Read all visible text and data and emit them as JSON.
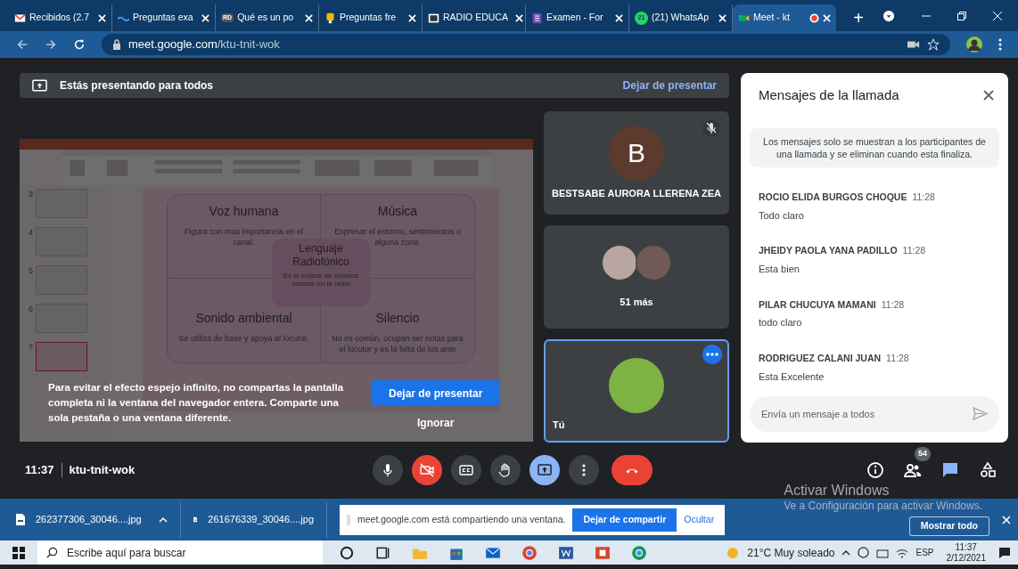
{
  "browser": {
    "tabs": [
      {
        "title": "Recibidos (2.7",
        "selected": false,
        "recording": false
      },
      {
        "title": "Preguntas exa",
        "selected": false,
        "recording": false
      },
      {
        "title": "Qué es un po",
        "badge": "RD",
        "selected": false,
        "recording": false
      },
      {
        "title": "Preguntas fre",
        "selected": false,
        "recording": false
      },
      {
        "title": "RADIO EDUCA",
        "selected": false,
        "recording": false
      },
      {
        "title": "Examen - For",
        "selected": false,
        "recording": false
      },
      {
        "title": "(21) WhatsAp",
        "badge": "21",
        "selected": false,
        "recording": false
      },
      {
        "title": "Meet - kt",
        "selected": true,
        "recording": true
      }
    ],
    "new_tab": "+",
    "host": "meet.google.com",
    "path": "/ktu-tnit-wok"
  },
  "presenting_banner": {
    "text": "Estás presentando para todos",
    "action": "Dejar de presentar"
  },
  "presentation": {
    "thumbnails": [
      "3",
      "4",
      "5",
      "6",
      "7"
    ],
    "cells": [
      {
        "title": "Voz humana",
        "body": "Figura con mas importancia en el canal."
      },
      {
        "title": "Música",
        "body": "Expresar el entorno, sentimientos o alguna zona."
      },
      {
        "title": "Sonido ambiental",
        "body": "Se utiliza de base y apoya al locutor."
      },
      {
        "title": "Silencio",
        "body": "No es común, ocupan ser notas para el locutor y es la falta de los ante"
      }
    ],
    "center": {
      "title": "Lenguaje Radiofónico",
      "body": "Es el enlace de sonidos usados en la radio"
    },
    "warning": {
      "text": "Para evitar el efecto espejo infinito, no compartas la pantalla completa ni la ventana del navegador entera. Comparte una sola pestaña o una ventana diferente.",
      "primary": "Dejar de presentar",
      "secondary": "Ignorar"
    }
  },
  "tiles": [
    {
      "kind": "initial",
      "initial": "B",
      "name": "BESTSABE AURORA LLERENA ZEA",
      "muted": true,
      "selected": false
    },
    {
      "kind": "group",
      "name": "51 más",
      "muted": false,
      "selected": false
    },
    {
      "kind": "self",
      "name": "Tú",
      "muted": false,
      "selected": true
    }
  ],
  "chat": {
    "title": "Mensajes de la llamada",
    "notice": "Los mensajes solo se muestran a los participantes de una llamada y se eliminan cuando esta finaliza.",
    "messages": [
      {
        "sender": "ROCIO ELIDA BURGOS CHOQUE",
        "time": "11:28",
        "text": "Todo claro"
      },
      {
        "sender": "JHEIDY PAOLA YANA PADILLO",
        "time": "11:28",
        "text": "Esta bien"
      },
      {
        "sender": "PILAR CHUCUYA MAMANI",
        "time": "11:28",
        "text": "todo claro"
      },
      {
        "sender": "RODRIGUEZ CALANI JUAN",
        "time": "11:28",
        "text": "Esta Excelente"
      }
    ],
    "placeholder": "Envía un mensaje a todos"
  },
  "controls": {
    "time": "11:37",
    "code": "ktu-tnit-wok",
    "buttons": [
      {
        "kind": "mic",
        "off": false
      },
      {
        "kind": "camera",
        "off": true
      },
      {
        "kind": "captions"
      },
      {
        "kind": "hand"
      },
      {
        "kind": "present"
      },
      {
        "kind": "more"
      },
      {
        "kind": "hangup"
      }
    ],
    "side": [
      {
        "kind": "info",
        "selected": false
      },
      {
        "kind": "people",
        "badge": "54",
        "selected": false
      },
      {
        "kind": "chat",
        "selected": true
      },
      {
        "kind": "activities",
        "selected": false
      }
    ]
  },
  "activation": {
    "title": "Activar Windows",
    "text": "Ve a Configuración para activar Windows."
  },
  "downloads": {
    "files": [
      {
        "name": "262377306_30046....jpg",
        "caret": true
      },
      {
        "name": "261676339_30046....jpg",
        "caret": false
      }
    ],
    "share_notice": {
      "text": "meet.google.com está compartiendo una ventana.",
      "button": "Dejar de compartir",
      "link": "Ocultar"
    },
    "show_all": "Mostrar todo"
  },
  "taskbar": {
    "search": "Escribe aquí para buscar",
    "weather": "21°C Muy soleado",
    "language": "ESP",
    "time": "11:37",
    "date": "2/12/2021"
  }
}
